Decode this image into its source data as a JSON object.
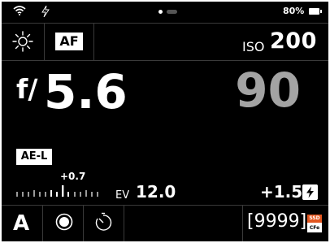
{
  "status_bar": {
    "battery_percent": "80%"
  },
  "top_row": {
    "af_label": "AF",
    "iso_label": "ISO",
    "iso_value": "200"
  },
  "exposure": {
    "aperture_prefix": "f/",
    "aperture_value": "5.6",
    "shutter_value": "90"
  },
  "metering": {
    "ae_lock_label": "AE-L",
    "ev_offset": "+0.7",
    "ev_label": "EV",
    "ev_value": "12.0",
    "flash_compensation": "+1.5"
  },
  "bottom_row": {
    "mode_letter": "A",
    "shots_remaining": "[9999]",
    "media_top_label": "SSD",
    "media_bottom_label": "CFe"
  },
  "colors": {
    "background": "#000000",
    "foreground": "#ffffff",
    "shutter_dim": "#a3a3a3",
    "media_accent": "#e2561f"
  },
  "icons": [
    "wifi-icon",
    "flash-small-icon",
    "white-balance-icon",
    "flash-icon",
    "record-icon",
    "self-timer-icon",
    "battery-icon"
  ]
}
